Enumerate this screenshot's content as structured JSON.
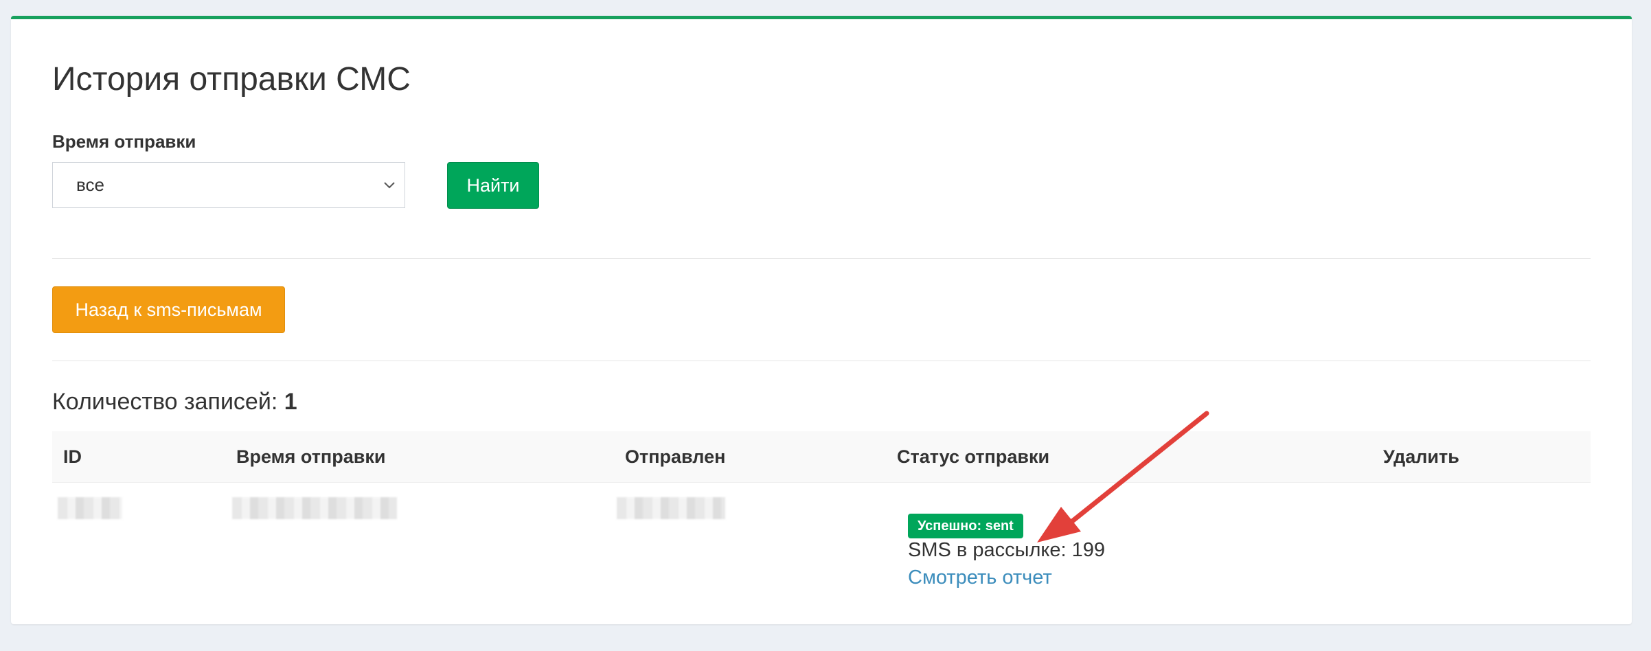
{
  "page": {
    "title": "История отправки СМС"
  },
  "filter": {
    "label": "Время отправки",
    "selected": "все",
    "find_label": "Найти"
  },
  "back_button": {
    "label": "Назад к sms-письмам"
  },
  "records": {
    "label": "Количество записей: ",
    "count": "1"
  },
  "table": {
    "columns": [
      "ID",
      "Время отправки",
      "Отправлен",
      "Статус отправки",
      "Удалить"
    ],
    "rows": [
      {
        "status_badge": "Успешно: sent",
        "sms_count": "SMS в рассылке: 199",
        "report_link": "Смотреть отчет"
      }
    ]
  },
  "colors": {
    "accent_green": "#00a65a",
    "warning_orange": "#f39c12",
    "link_blue": "#3c8dbc",
    "annotation_arrow": "#e2403a"
  }
}
